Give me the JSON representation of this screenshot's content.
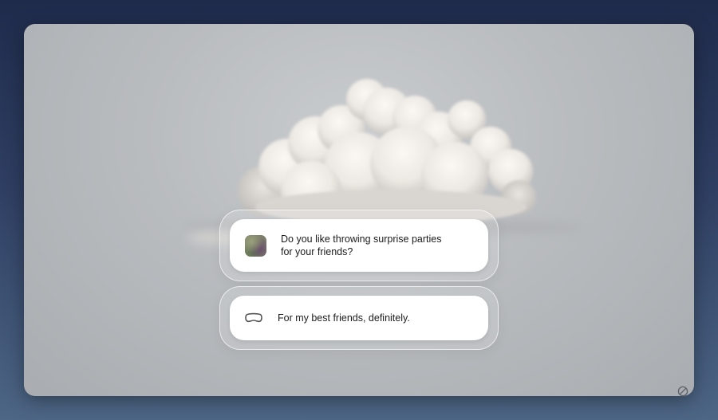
{
  "conversation": {
    "question": "Do you like throwing surprise parties for your friends?",
    "answer": "For my best friends, definitely."
  },
  "icons": {
    "avatar": "avatar-thumbnail",
    "answer": "vision-pro-goggles-icon",
    "corner": "no-entry-icon"
  }
}
